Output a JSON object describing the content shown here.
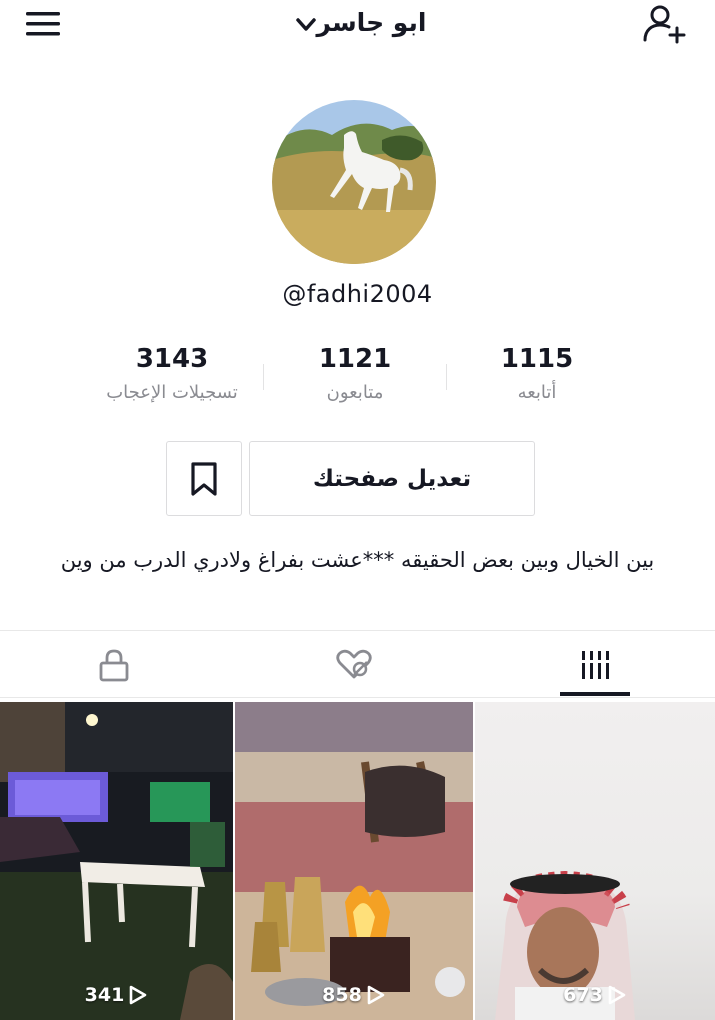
{
  "header": {
    "title": "ابو جاسر"
  },
  "profile": {
    "username": "@fadhi2004",
    "bio": "بين الخيال وبين بعض الحقيقه ***عشت بفراغ ولادري الدرب من وين"
  },
  "stats": [
    {
      "value": "1115",
      "label": "أتابعه"
    },
    {
      "value": "1121",
      "label": "متابعون"
    },
    {
      "value": "3143",
      "label": "تسجيلات الإعجاب"
    }
  ],
  "actions": {
    "edit_label": "تعديل صفحتك"
  },
  "videos": [
    {
      "views": "673"
    },
    {
      "views": "858"
    },
    {
      "views": "341"
    }
  ],
  "icons": {
    "menu": "hamburger-menu-icon",
    "add_user": "add-user-icon",
    "bookmark": "bookmark-icon",
    "videos_tab": "grid-bars-icon",
    "liked_tab": "hidden-heart-icon",
    "private_tab": "lock-icon"
  }
}
